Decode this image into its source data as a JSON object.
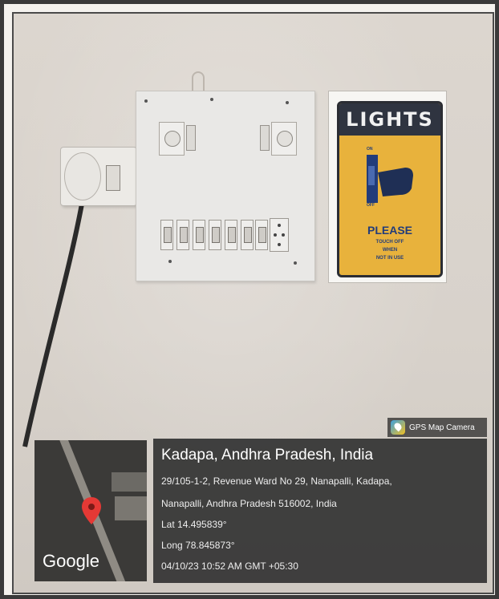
{
  "sign": {
    "title": "LIGHTS",
    "message": "PLEASE",
    "on_label": "ON",
    "off_label": "OFF",
    "fine_print": [
      "TOUCH OFF",
      "WHEN",
      "NOT IN USE"
    ]
  },
  "gps_badge": {
    "label": "GPS Map Camera",
    "icon": "gps-map-camera-icon"
  },
  "map": {
    "logo_text": "Google",
    "marker_icon": "map-pin-icon",
    "marker_color": "#e53935"
  },
  "location": {
    "title": "Kadapa, Andhra Pradesh, India",
    "address_line1": "29/105-1-2, Revenue Ward No 29, Nanapalli, Kadapa,",
    "address_line2": "Nanapalli, Andhra Pradesh 516002, India",
    "latitude": "Lat 14.495839°",
    "longitude": "Long 78.845873°",
    "timestamp": "04/10/23 10:52 AM GMT +05:30"
  },
  "colors": {
    "panel_background": "#343434",
    "sign_yellow": "#e8b23c",
    "sign_header": "#2f3440"
  }
}
